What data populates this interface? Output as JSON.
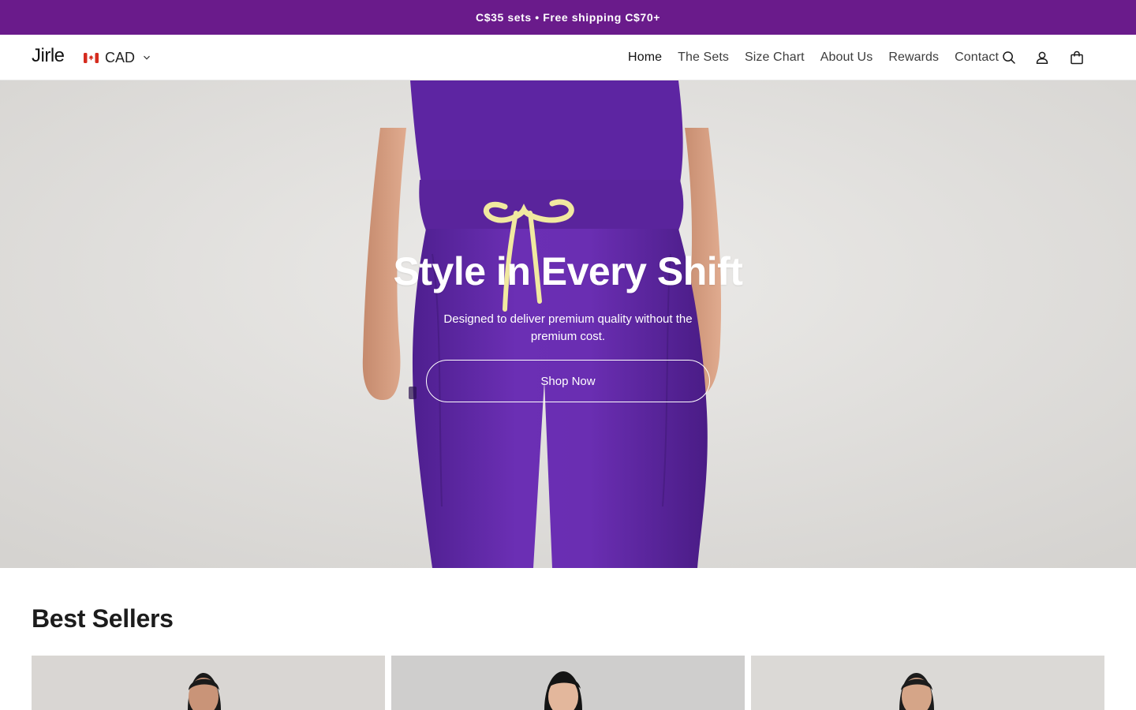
{
  "announcement": {
    "text": "C$35 sets • Free shipping C$70+",
    "background": "#6a1b8b"
  },
  "header": {
    "logo": "Jirle",
    "currency": {
      "label": "CAD",
      "flag_icon": "canada-flag-icon"
    },
    "nav": [
      {
        "label": "Home",
        "active": true
      },
      {
        "label": "The Sets",
        "active": false
      },
      {
        "label": "Size Chart",
        "active": false
      },
      {
        "label": "About Us",
        "active": false
      },
      {
        "label": "Rewards",
        "active": false
      },
      {
        "label": "Contact",
        "active": false
      }
    ],
    "icons": [
      "search-icon",
      "account-icon",
      "cart-icon"
    ]
  },
  "hero": {
    "title": "Style in Every Shift",
    "subtitle": "Designed to deliver premium quality without the premium cost.",
    "cta_label": "Shop Now",
    "scrub_color": "#6a2bb0"
  },
  "best_sellers": {
    "title": "Best Sellers",
    "cards": [
      {
        "name": "product-card-1"
      },
      {
        "name": "product-card-2"
      },
      {
        "name": "product-card-3"
      }
    ]
  }
}
